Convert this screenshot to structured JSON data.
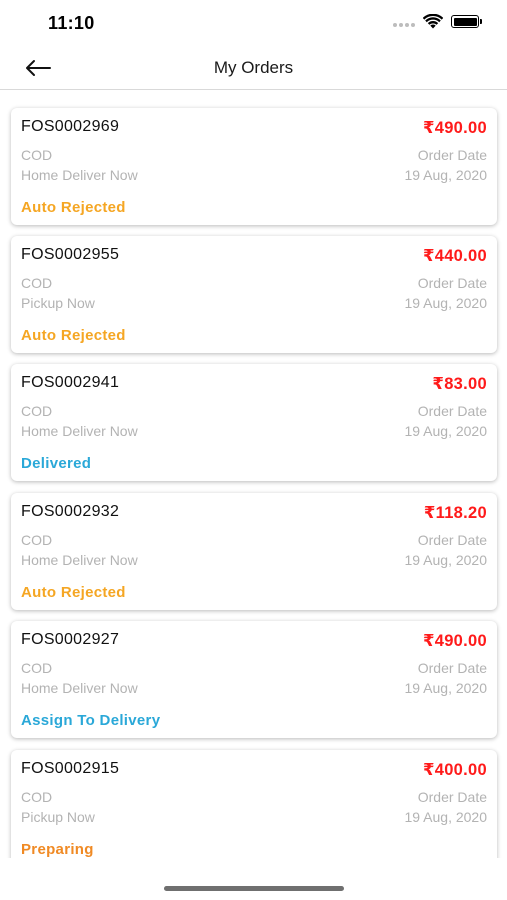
{
  "status_bar": {
    "time": "11:10"
  },
  "nav": {
    "title": "My Orders"
  },
  "colors": {
    "amount": "#ff1a1a",
    "status_rejected": "#f5a623",
    "status_delivered": "#2aa8d8",
    "status_preparing": "#f08a24"
  },
  "orders": [
    {
      "id": "FOS0002969",
      "amount": "₹490.00",
      "payment": "COD",
      "delivery": "Home Deliver Now",
      "date_label": "Order Date",
      "date": "19 Aug, 2020",
      "status": "Auto Rejected",
      "status_color": "#f5a623"
    },
    {
      "id": "FOS0002955",
      "amount": "₹440.00",
      "payment": "COD",
      "delivery": "Pickup Now",
      "date_label": "Order Date",
      "date": "19 Aug, 2020",
      "status": "Auto Rejected",
      "status_color": "#f5a623"
    },
    {
      "id": "FOS0002941",
      "amount": "₹83.00",
      "payment": "COD",
      "delivery": "Home Deliver Now",
      "date_label": "Order Date",
      "date": "19 Aug, 2020",
      "status": "Delivered",
      "status_color": "#2aa8d8"
    },
    {
      "id": "FOS0002932",
      "amount": "₹118.20",
      "payment": "COD",
      "delivery": "Home Deliver Now",
      "date_label": "Order Date",
      "date": "19 Aug, 2020",
      "status": "Auto Rejected",
      "status_color": "#f5a623"
    },
    {
      "id": "FOS0002927",
      "amount": "₹490.00",
      "payment": "COD",
      "delivery": "Home Deliver Now",
      "date_label": "Order Date",
      "date": "19 Aug, 2020",
      "status": "Assign To Delivery",
      "status_color": "#2aa8d8"
    },
    {
      "id": "FOS0002915",
      "amount": "₹400.00",
      "payment": "COD",
      "delivery": "Pickup Now",
      "date_label": "Order Date",
      "date": "19 Aug, 2020",
      "status": "Preparing",
      "status_color": "#f08a24"
    }
  ]
}
